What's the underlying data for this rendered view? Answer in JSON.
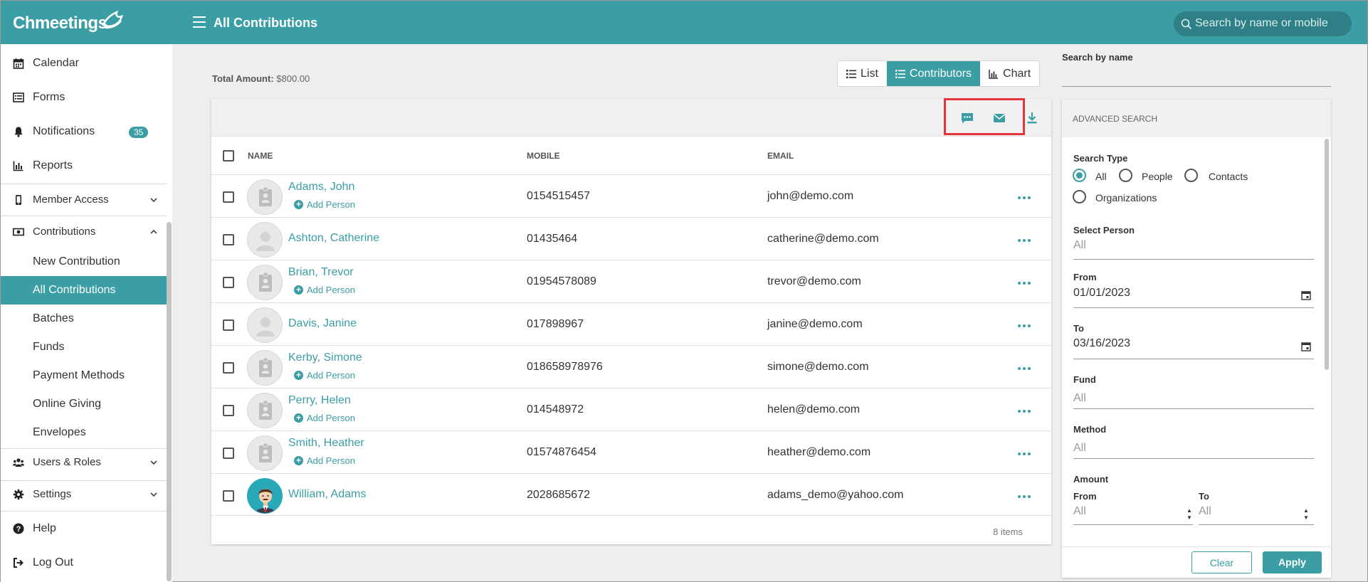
{
  "app": {
    "name": "Chmeetings",
    "page_title": "All Contributions"
  },
  "search": {
    "placeholder": "Search by name or mobile"
  },
  "sidebar": {
    "items": [
      {
        "label": "Calendar",
        "icon": "calendar-icon"
      },
      {
        "label": "Forms",
        "icon": "list-icon"
      },
      {
        "label": "Notifications",
        "icon": "bell-icon",
        "badge": "35"
      },
      {
        "label": "Reports",
        "icon": "bar-chart-icon"
      },
      {
        "label": "Member Access",
        "icon": "mobile-icon"
      },
      {
        "label": "Contributions",
        "icon": "money-icon"
      },
      {
        "label": "Users & Roles",
        "icon": "users-icon"
      },
      {
        "label": "Settings",
        "icon": "gear-icon"
      },
      {
        "label": "Help",
        "icon": "question-icon"
      },
      {
        "label": "Log Out",
        "icon": "logout-icon"
      }
    ],
    "contributions_sub": [
      {
        "label": "New Contribution",
        "active": false
      },
      {
        "label": "All Contributions",
        "active": true
      },
      {
        "label": "Batches",
        "active": false
      },
      {
        "label": "Funds",
        "active": false
      },
      {
        "label": "Payment Methods",
        "active": false
      },
      {
        "label": "Online Giving",
        "active": false
      },
      {
        "label": "Envelopes",
        "active": false
      }
    ]
  },
  "summary": {
    "total_label": "Total Amount:",
    "total_value": "$800.00"
  },
  "view_tabs": [
    {
      "label": "List",
      "active": false
    },
    {
      "label": "Contributors",
      "active": true
    },
    {
      "label": "Chart",
      "active": false
    }
  ],
  "table": {
    "columns": {
      "name": "NAME",
      "mobile": "MOBILE",
      "email": "EMAIL"
    },
    "add_person_label": "Add Person",
    "rows": [
      {
        "name": "Adams, John",
        "mobile": "0154515457",
        "email": "john@demo.com",
        "avatar": "badge"
      },
      {
        "name": "Ashton, Catherine",
        "mobile": "01435464",
        "email": "catherine@demo.com",
        "avatar": "person"
      },
      {
        "name": "Brian, Trevor",
        "mobile": "01954578089",
        "email": "trevor@demo.com",
        "avatar": "badge"
      },
      {
        "name": "Davis, Janine",
        "mobile": "017898967",
        "email": "janine@demo.com",
        "avatar": "person"
      },
      {
        "name": "Kerby, Simone",
        "mobile": "018658978976",
        "email": "simone@demo.com",
        "avatar": "badge"
      },
      {
        "name": "Perry, Helen",
        "mobile": "014548972",
        "email": "helen@demo.com",
        "avatar": "badge"
      },
      {
        "name": "Smith, Heather",
        "mobile": "01574876454",
        "email": "heather@demo.com",
        "avatar": "badge"
      },
      {
        "name": "William, Adams",
        "mobile": "2028685672",
        "email": "adams_demo@yahoo.com",
        "avatar": "photo"
      }
    ],
    "footer": "8 items"
  },
  "right_panel": {
    "search_by_name_label": "Search by name",
    "advanced_title": "ADVANCED SEARCH",
    "search_type_label": "Search Type",
    "search_types": [
      "All",
      "People",
      "Contacts",
      "Organizations"
    ],
    "search_type_selected": "All",
    "select_person_label": "Select Person",
    "select_person_value": "All",
    "from_label": "From",
    "from_value": "01/01/2023",
    "to_label": "To",
    "to_value": "03/16/2023",
    "fund_label": "Fund",
    "fund_value": "All",
    "method_label": "Method",
    "method_value": "All",
    "amount_label": "Amount",
    "amount_from_label": "From",
    "amount_from_value": "All",
    "amount_to_label": "To",
    "amount_to_value": "All",
    "clear_label": "Clear",
    "apply_label": "Apply"
  },
  "colors": {
    "accent": "#3b9ea5",
    "highlight_box": "#e3353b"
  }
}
